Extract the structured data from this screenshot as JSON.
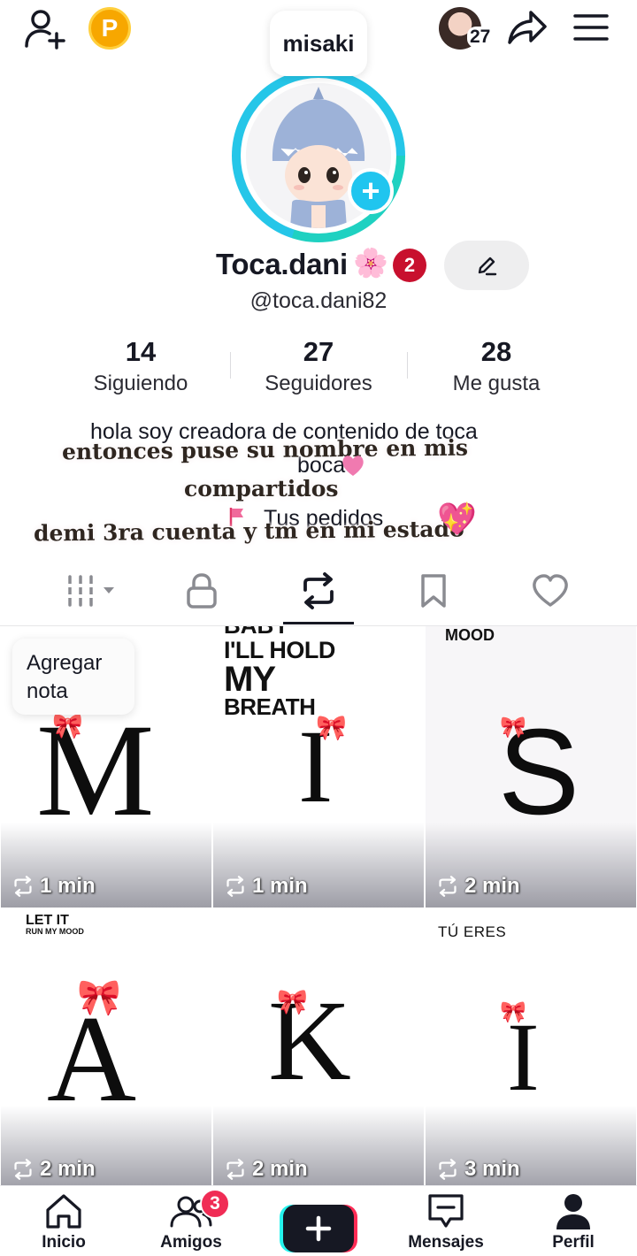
{
  "top_bar": {
    "add_friend_icon": "person-plus-icon",
    "coin_label": "P",
    "story_count": "27",
    "share_icon": "share-arrow-icon",
    "menu_icon": "hamburger-menu-icon"
  },
  "profile": {
    "nickname_bubble": "misaki",
    "display_name": "Toca.dani",
    "name_emoji": "🌸",
    "badge_count": "2",
    "username": "@toca.dani82",
    "edit_icon": "pencil-icon"
  },
  "stats": [
    {
      "value": "14",
      "label": "Siguiendo"
    },
    {
      "value": "27",
      "label": "Seguidores"
    },
    {
      "value": "28",
      "label": "Me gusta"
    }
  ],
  "bio": {
    "line1": "hola soy creadora de contenido de toca",
    "line2": "boca",
    "line3": "Tus pedidos",
    "overlay_line1": "entonces puse su nombre en mis",
    "overlay_line2": "compartidos",
    "overlay_line3": "demi 3ra cuenta y tm en mi estado",
    "overlay_emoji": "💖"
  },
  "tabs": [
    {
      "name": "videos",
      "icon": "grid-columns-icon"
    },
    {
      "name": "private",
      "icon": "lock-icon"
    },
    {
      "name": "reposts",
      "icon": "repost-icon",
      "active": true
    },
    {
      "name": "favorites",
      "icon": "bookmark-icon"
    },
    {
      "name": "liked",
      "icon": "heart-icon"
    }
  ],
  "note_pill": "Agregar nota",
  "grid": [
    {
      "letter": "M",
      "duration": "1 min",
      "caption": ""
    },
    {
      "letter": "I",
      "duration": "1 min",
      "caption": "I'LL HOLD MY BREATH"
    },
    {
      "letter": "S",
      "duration": "2 min",
      "caption": "MOOD"
    },
    {
      "letter": "A",
      "duration": "2 min",
      "caption": "LET IT RUN MY MOOD"
    },
    {
      "letter": "K",
      "duration": "2 min",
      "caption": ""
    },
    {
      "letter": "I",
      "duration": "3 min",
      "caption": "TÚ ERES"
    }
  ],
  "grid_captions": {
    "tile2_top": "BABY",
    "tile2_line1": "I'LL HOLD",
    "tile2_line2": "MY",
    "tile2_line3": "BREATH",
    "tile3": "MOOD",
    "tile4_line1": "LET IT",
    "tile4_line2": "RUN MY MOOD",
    "tile6": "TÚ ERES"
  },
  "bottom_nav": [
    {
      "label": "Inicio",
      "icon": "home-icon"
    },
    {
      "label": "Amigos",
      "icon": "friends-icon",
      "badge": "3"
    },
    {
      "label": "",
      "icon": "create-plus-icon"
    },
    {
      "label": "Mensajes",
      "icon": "message-icon"
    },
    {
      "label": "Perfil",
      "icon": "profile-icon"
    }
  ],
  "colors": {
    "ring": "#25c6e8",
    "badge_red": "#c8102e",
    "nav_badge": "#f02c55",
    "plus_blue": "#20c5ef"
  }
}
